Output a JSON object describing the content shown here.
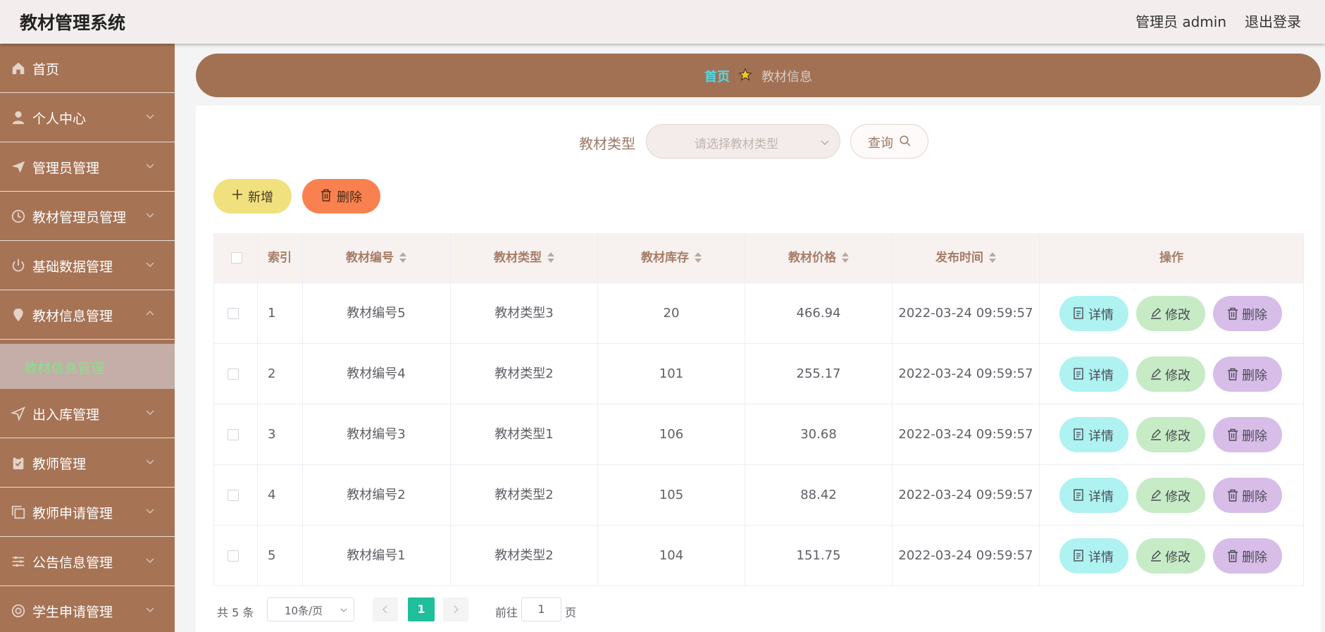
{
  "app": {
    "title": "教材管理系统"
  },
  "header": {
    "user_label": "管理员 admin",
    "logout_label": "退出登录"
  },
  "sidebar": {
    "items": [
      {
        "label": "首页",
        "icon": "home-icon"
      },
      {
        "label": "个人中心",
        "icon": "user-icon"
      },
      {
        "label": "管理员管理",
        "icon": "send-icon"
      },
      {
        "label": "教材管理员管理",
        "icon": "clock-icon"
      },
      {
        "label": "基础数据管理",
        "icon": "power-icon"
      },
      {
        "label": "教材信息管理",
        "icon": "location-icon"
      },
      {
        "label": "出入库管理",
        "icon": "navigation-icon"
      },
      {
        "label": "教师管理",
        "icon": "clipboard-icon"
      },
      {
        "label": "教师申请管理",
        "icon": "copy-icon"
      },
      {
        "label": "公告信息管理",
        "icon": "sliders-icon"
      },
      {
        "label": "学生申请管理",
        "icon": "target-icon"
      }
    ],
    "active_sub": "教材信息管理",
    "colors": {
      "bg": "#a67355",
      "sub_bg": "#c4aea7",
      "sub_text": "#8be08b"
    }
  },
  "breadcrumb": {
    "home": "首页",
    "current": "教材信息"
  },
  "search": {
    "label": "教材类型",
    "placeholder": "请选择教材类型",
    "button": "查询"
  },
  "actions": {
    "add": "新增",
    "delete": "删除"
  },
  "table": {
    "headers": [
      "索引",
      "教材编号",
      "教材类型",
      "教材库存",
      "教材价格",
      "发布时间",
      "操作"
    ],
    "rows": [
      {
        "index": "1",
        "code": "教材编号5",
        "type": "教材类型3",
        "stock": "20",
        "price": "466.94",
        "time": "2022-03-24 09:59:57"
      },
      {
        "index": "2",
        "code": "教材编号4",
        "type": "教材类型2",
        "stock": "101",
        "price": "255.17",
        "time": "2022-03-24 09:59:57"
      },
      {
        "index": "3",
        "code": "教材编号3",
        "type": "教材类型1",
        "stock": "106",
        "price": "30.68",
        "time": "2022-03-24 09:59:57"
      },
      {
        "index": "4",
        "code": "教材编号2",
        "type": "教材类型2",
        "stock": "105",
        "price": "88.42",
        "time": "2022-03-24 09:59:57"
      },
      {
        "index": "5",
        "code": "教材编号1",
        "type": "教材类型2",
        "stock": "104",
        "price": "151.75",
        "time": "2022-03-24 09:59:57"
      }
    ],
    "row_actions": {
      "detail": "详情",
      "edit": "修改",
      "delete": "删除"
    }
  },
  "pagination": {
    "total": "共 5 条",
    "page_size": "10条/页",
    "current_page": "1",
    "goto_label": "前往",
    "goto_value": "1",
    "page_suffix": "页"
  },
  "colors": {
    "topbar": "#f3eeed",
    "breadcrumb_bg": "#a27154",
    "breadcrumb_home": "#4fd9e8",
    "add": "#f0e17e",
    "delete": "#f8814f",
    "detail": "#aef2f1",
    "edit": "#c6ebc5",
    "row_delete": "#d7bde8",
    "page_active": "#1fbf9a"
  }
}
